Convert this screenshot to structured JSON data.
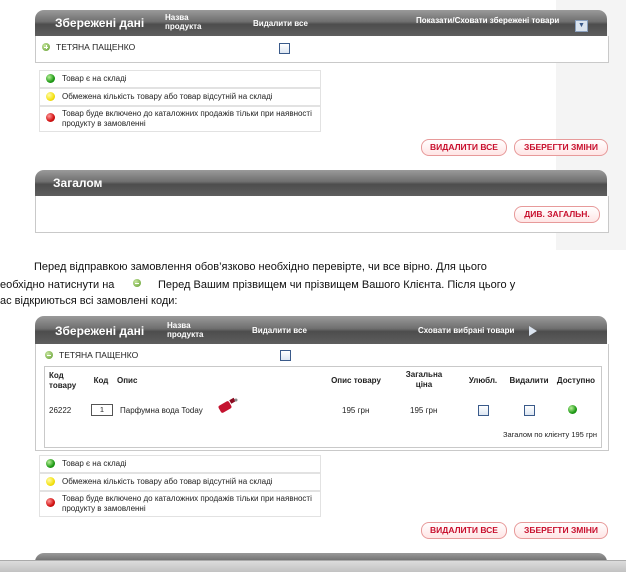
{
  "panel1": {
    "title": "Збережені дані",
    "col_product_name": "Назва продукта",
    "col_delete_all": "Видалити все",
    "toggle_label": "Показати/Сховати збережені товари",
    "customer_name": "ТЕТЯНА ПАЩЕНКО"
  },
  "legend1": {
    "in_stock": "Товар є на складі",
    "limited": "Обмежена кількість товару або товар відсутній на складі",
    "catalog_only": "Товар буде включено до каталожних продажів тільки при наявності продукту в замовленні"
  },
  "buttons1": {
    "delete_all": "ВИДАЛИТИ ВСЕ",
    "save_changes": "ЗБЕРЕГТИ ЗМІНИ"
  },
  "panel_total": {
    "title": "Загалом",
    "view_total": "ДИВ. ЗАГАЛЬН."
  },
  "instructions": {
    "line1": "Перед відправкою замовлення обов’язково необхідно перевірте, чи все вірно. Для цього",
    "line2a": "еобхідно натиснути на",
    "line2b": "Перед Вашим прізвищем чи прізвищем Вашого Клієнта. Після цього у",
    "line3": "ас відкриються всі замовлені коди:"
  },
  "panel2": {
    "title": "Збережені дані",
    "col_product_name": "Назва продукта",
    "col_delete_all": "Видалити все",
    "toggle_label": "Сховати вибрані товари",
    "customer_name": "ТЕТЯНА ПАЩЕНКО",
    "table": {
      "headers": {
        "product_code": "Код товару",
        "code": "Код",
        "description": "Опис",
        "price_desc": "Опис товару",
        "total_price": "Загальна ціна",
        "favorite": "Улюбл.",
        "delete": "Видалити",
        "available": "Доступно"
      },
      "rows": [
        {
          "product_code": "26222",
          "code": "1",
          "description": "Парфумна вода Today",
          "price": "195 грн",
          "total": "195 грн",
          "availability": "in-stock"
        }
      ],
      "client_total": "Загалом по клієнту 195 грн"
    }
  },
  "legend2": {
    "in_stock": "Товар є на складі",
    "limited": "Обмежена кількість товару або товар відсутній на складі",
    "catalog_only": "Товар буде включено до каталожних продажів тільки при наявності продукту в замовленні"
  },
  "buttons2": {
    "delete_all": "ВИДАЛИТИ ВСЕ",
    "save_changes": "ЗБЕРЕГТИ ЗМІНИ"
  },
  "colors": {
    "accent_red": "#c8102e",
    "header_gray": "#5e5e5e",
    "in_stock": "#1e9a15",
    "limited": "#f4e10e",
    "catalog_only": "#d21010"
  }
}
